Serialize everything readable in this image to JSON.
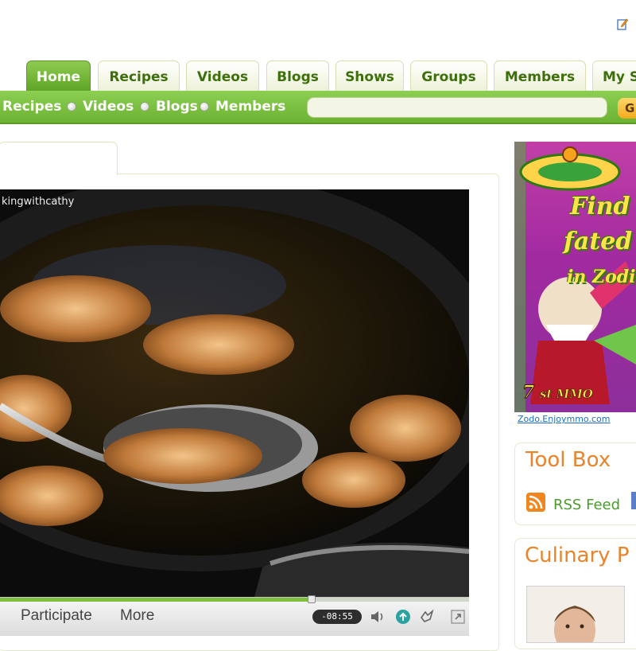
{
  "nav": {
    "tabs": [
      {
        "label": "Home",
        "active": true
      },
      {
        "label": "Recipes"
      },
      {
        "label": "Videos"
      },
      {
        "label": "Blogs"
      },
      {
        "label": "Shows"
      },
      {
        "label": "Groups"
      },
      {
        "label": "Members"
      },
      {
        "label": "My S"
      }
    ]
  },
  "search": {
    "options": [
      "Recipes",
      "Videos",
      "Blogs",
      "Members"
    ],
    "go_label": "G"
  },
  "video": {
    "watermark": "kingwithcathy",
    "controls": {
      "participate_label": "Participate",
      "more_label": "More",
      "time": "-08:55",
      "progress_fraction": 0.665
    }
  },
  "ad": {
    "headline": [
      "Find",
      "fated",
      "in Zodi"
    ],
    "footer_url": "Zodo.Enjoymmo.com"
  },
  "toolbox": {
    "title": "Tool Box",
    "rss_label": "RSS Feed"
  },
  "culinary": {
    "title": "Culinary P"
  },
  "colors": {
    "brand_green": "#6cb233",
    "tab_text": "#3d6f0c",
    "accent_orange": "#e9842a",
    "link_green": "#4a9b2c"
  },
  "icons": {
    "top_right": "edit-note-icon",
    "rss": "rss-feed-icon",
    "volume": "volume-icon",
    "share": "share-icon",
    "fullscreen": "fullscreen-icon"
  }
}
